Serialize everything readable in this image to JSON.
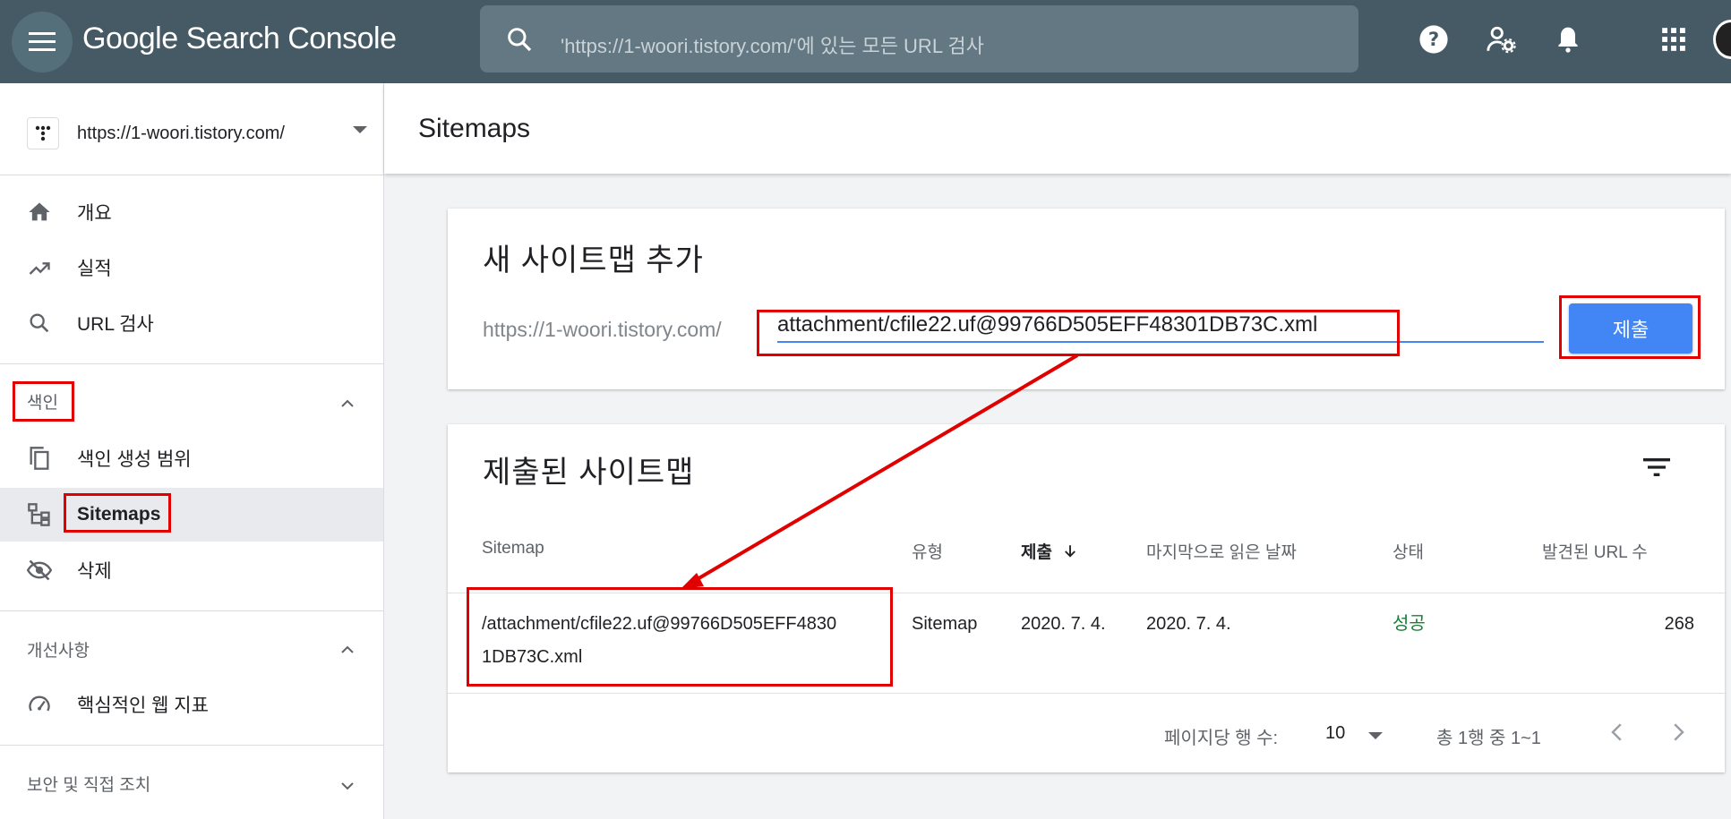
{
  "topbar": {
    "app_title": "Google Search Console",
    "search_placeholder": "'https://1-woori.tistory.com/'에 있는 모든 URL 검사"
  },
  "sidebar": {
    "property_url": "https://1-woori.tistory.com/",
    "items": [
      {
        "label": "개요",
        "icon": "home-icon"
      },
      {
        "label": "실적",
        "icon": "trending-up-icon"
      },
      {
        "label": "URL 검사",
        "icon": "search-icon"
      }
    ],
    "index_section": {
      "label": "색인",
      "items": [
        {
          "label": "색인 생성 범위",
          "icon": "copy-icon"
        },
        {
          "label": "Sitemaps",
          "icon": "sitemap-icon",
          "active": true
        },
        {
          "label": "삭제",
          "icon": "visibility-off-icon"
        }
      ]
    },
    "enhancements_section": {
      "label": "개선사항",
      "items": [
        {
          "label": "핵심적인 웹 지표",
          "icon": "speed-icon"
        }
      ]
    },
    "security_section": {
      "label": "보안 및 직접 조치"
    }
  },
  "main": {
    "title": "Sitemaps",
    "add_card": {
      "title": "새 사이트맵 추가",
      "prefix": "https://1-woori.tistory.com/",
      "input_value": "attachment/cfile22.uf@99766D505EFF48301DB73C.xml",
      "submit_label": "제출"
    },
    "submitted_card": {
      "title": "제출된 사이트맵",
      "columns": [
        "Sitemap",
        "유형",
        "제출",
        "마지막으로 읽은 날짜",
        "상태",
        "발견된 URL 수"
      ],
      "rows": [
        {
          "sitemap_line1": "/attachment/cfile22.uf@99766D505EFF4830",
          "sitemap_line2": "1DB73C.xml",
          "type": "Sitemap",
          "submitted": "2020. 7. 4.",
          "last_read": "2020. 7. 4.",
          "status": "성공",
          "discovered_urls": "268"
        }
      ],
      "footer": {
        "rows_per_page_label": "페이지당 행 수:",
        "rows_per_page_value": "10",
        "range_text": "총 1행 중 1~1"
      }
    }
  },
  "colors": {
    "topbar": "#455a64",
    "accent": "#4285f4",
    "success": "#188038",
    "highlight": "#e00000"
  }
}
